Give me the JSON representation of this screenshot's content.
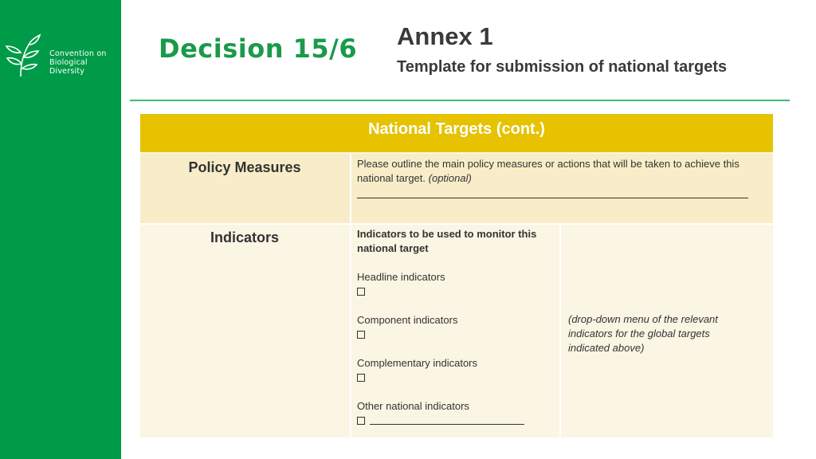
{
  "sidebar": {
    "logo": {
      "icon": "leaf-plant-icon",
      "line1": "Convention on",
      "line2": "Biological Diversity"
    }
  },
  "header": {
    "decision": "Decision 15/6",
    "annex_title": "Annex 1",
    "annex_subtitle": "Template for submission of national targets"
  },
  "table": {
    "title": "National Targets (cont.)",
    "rows": [
      {
        "label": "Policy Measures",
        "text": "Please outline the main policy measures or actions that will be taken to achieve this",
        "text2": "national target.",
        "optional": "(optional)"
      },
      {
        "label": "Indicators",
        "intro_line1": "Indicators to be used to monitor this",
        "intro_line2": "national target",
        "options": [
          {
            "label": "Headline indicators",
            "checked": false
          },
          {
            "label": "Component indicators",
            "checked": false
          },
          {
            "label": "Complementary indicators",
            "checked": false
          },
          {
            "label": "Other national indicators",
            "checked": false
          }
        ],
        "dropdown_note_1": "(drop-down menu of the relevant",
        "dropdown_note_2": "indicators for the global targets",
        "dropdown_note_3": "indicated above)"
      }
    ]
  },
  "colors": {
    "sidebar": "#009b48",
    "decision": "#1a9a4a",
    "header_bar": "#e6c200",
    "rule": "#3cb878"
  }
}
